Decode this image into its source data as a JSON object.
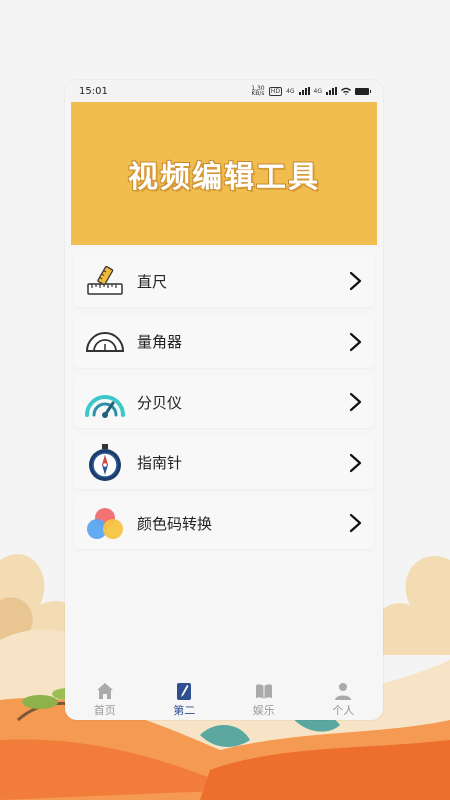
{
  "statusbar": {
    "time": "15:01",
    "net_speed": "1.30 KB/s",
    "hd": "HD",
    "sig1": "4G",
    "sig2": "4G"
  },
  "banner": {
    "title": "视频编辑工具"
  },
  "tools": [
    {
      "label": "直尺",
      "icon": "ruler-icon"
    },
    {
      "label": "量角器",
      "icon": "protractor-icon"
    },
    {
      "label": "分贝仪",
      "icon": "decibel-meter-icon"
    },
    {
      "label": "指南针",
      "icon": "compass-icon"
    },
    {
      "label": "颜色码转换",
      "icon": "color-circles-icon"
    }
  ],
  "tabs": [
    {
      "label": "首页",
      "icon": "home-icon",
      "active": false
    },
    {
      "label": "第二",
      "icon": "edit-icon",
      "active": true
    },
    {
      "label": "娱乐",
      "icon": "book-icon",
      "active": false
    },
    {
      "label": "个人",
      "icon": "person-icon",
      "active": false
    }
  ],
  "colors": {
    "banner": "#f2bd4f",
    "active_tab": "#2f4f8f",
    "inactive_tab": "#999999"
  }
}
